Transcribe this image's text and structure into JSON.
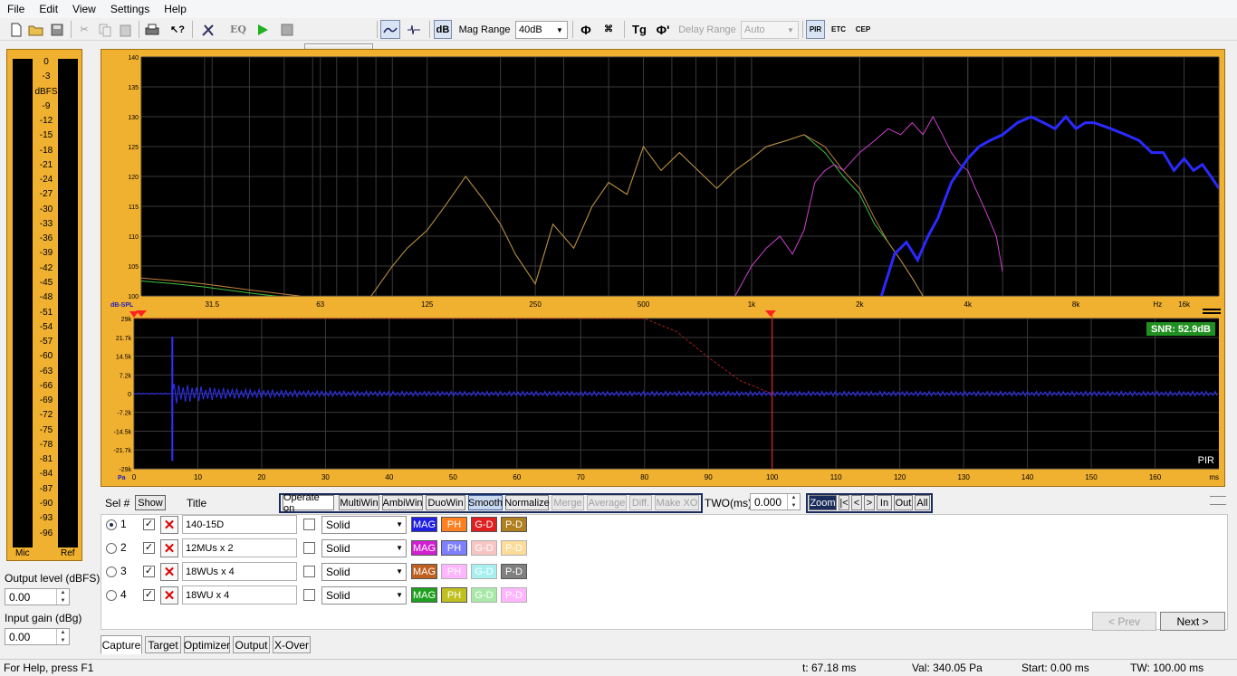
{
  "menu": [
    "File",
    "Edit",
    "View",
    "Settings",
    "Help"
  ],
  "toolbar": {
    "eq_label": "EQ",
    "db_label": "dB",
    "mag_range_label": "Mag Range",
    "mag_range_value": "40dB",
    "tg_label": "Tg",
    "delay_range_label": "Delay Range",
    "delay_range_value": "Auto",
    "pir_label": "PIR",
    "etc_label": "ETC",
    "cep_label": "CEP"
  },
  "meters": {
    "unit": "dBFS",
    "scale": [
      "0",
      "-3",
      "-9",
      "-12",
      "-15",
      "-18",
      "-21",
      "-24",
      "-27",
      "-30",
      "-33",
      "-36",
      "-39",
      "-42",
      "-45",
      "-48",
      "-51",
      "-54",
      "-57",
      "-60",
      "-63",
      "-66",
      "-69",
      "-72",
      "-75",
      "-78",
      "-81",
      "-84",
      "-87",
      "-90",
      "-93",
      "-96"
    ],
    "mic_label": "Mic",
    "ref_label": "Ref"
  },
  "output_level": {
    "label": "Output level (dBFS)",
    "value": "0.00"
  },
  "input_gain": {
    "label": "Input gain (dBg)",
    "value": "0.00"
  },
  "colors": {
    "frame": "#f0b030",
    "plot_bg": "#000000",
    "grid": "#3a3a3a",
    "trace1": "#2a2aff",
    "trace2": "#d040d0",
    "trace3": "#c08040",
    "trace4": "#40c040",
    "pir": "#3030ff",
    "marker": "#ff2020"
  },
  "chart_data": [
    {
      "type": "line",
      "title": "",
      "xlabel": "Hz",
      "ylabel": "dB-SPL",
      "x_scale": "log",
      "xlim": [
        20,
        20000
      ],
      "ylim": [
        100,
        140
      ],
      "xticks": [
        {
          "v": 31.5,
          "label": "31.5"
        },
        {
          "v": 63,
          "label": "63"
        },
        {
          "v": 125,
          "label": "125"
        },
        {
          "v": 250,
          "label": "250"
        },
        {
          "v": 500,
          "label": "500"
        },
        {
          "v": 1000,
          "label": "1k"
        },
        {
          "v": 2000,
          "label": "2k"
        },
        {
          "v": 4000,
          "label": "4k"
        },
        {
          "v": 8000,
          "label": "8k"
        },
        {
          "v": 16000,
          "label": "16k"
        }
      ],
      "yticks": [
        100,
        105,
        110,
        115,
        120,
        125,
        130,
        135,
        140
      ],
      "series": [
        {
          "name": "140-15D",
          "color": "#2a2aff",
          "x": [
            2300,
            2500,
            2700,
            2900,
            3100,
            3300,
            3600,
            4000,
            4300,
            4600,
            5000,
            5500,
            6000,
            6500,
            7000,
            7500,
            8000,
            8500,
            9000,
            10000,
            11000,
            12000,
            13000,
            14000,
            15000,
            16000,
            17000,
            18000,
            19000,
            20000
          ],
          "y": [
            100,
            107,
            109,
            106,
            110,
            113,
            119,
            123,
            125,
            126,
            127,
            129,
            130,
            129,
            128,
            130,
            128,
            129,
            129,
            128,
            127,
            126,
            124,
            124,
            121,
            123,
            121,
            122,
            120,
            118
          ]
        },
        {
          "name": "12MUs x 2",
          "color": "#d040d0",
          "x": [
            900,
            1000,
            1100,
            1200,
            1300,
            1400,
            1500,
            1600,
            1700,
            1800,
            2000,
            2200,
            2400,
            2600,
            2800,
            3000,
            3200,
            3400,
            3600,
            3800,
            4000,
            4200,
            4500,
            4800,
            5000
          ],
          "y": [
            100,
            105,
            108,
            110,
            107,
            111,
            119,
            121,
            122,
            121,
            124,
            126,
            128,
            127,
            129,
            127,
            130,
            127,
            124,
            122,
            121,
            118,
            114,
            110,
            104
          ]
        },
        {
          "name": "18WUs x 4",
          "color": "#c08040",
          "x": [
            20,
            25,
            30,
            40,
            55,
            70,
            85,
            100,
            110,
            125,
            140,
            160,
            180,
            200,
            220,
            250,
            280,
            320,
            360,
            400,
            450,
            500,
            560,
            630,
            710,
            800,
            900,
            1000,
            1100,
            1250,
            1400,
            1600,
            1800,
            2000,
            2200,
            2400,
            2600,
            2800,
            3000
          ],
          "y": [
            103,
            102.5,
            102,
            101,
            100,
            98,
            99,
            105,
            108,
            111,
            115,
            120,
            116,
            112,
            107,
            102,
            112,
            108,
            115,
            119,
            117,
            125,
            121,
            124,
            121,
            118,
            121,
            123,
            125,
            126,
            127,
            125,
            121,
            118,
            113,
            109,
            106,
            103,
            100
          ]
        },
        {
          "name": "18WU x 4",
          "color": "#40c040",
          "x": [
            20,
            25,
            30,
            40,
            55,
            70,
            85,
            100,
            110,
            125,
            140,
            160,
            180,
            200,
            220,
            250,
            280,
            320,
            360,
            400,
            450,
            500,
            560,
            630,
            710,
            800,
            900,
            1000,
            1100,
            1250,
            1400,
            1600,
            1800,
            2000,
            2200,
            2400,
            2600,
            2800,
            3000
          ],
          "y": [
            102.5,
            102,
            101.5,
            100.5,
            99.5,
            98,
            99,
            105,
            108,
            111,
            115,
            120,
            116,
            112,
            107,
            102,
            112,
            108,
            115,
            119,
            117,
            125,
            121,
            124,
            121,
            118,
            121,
            123,
            125,
            126,
            127,
            124,
            120,
            117,
            112,
            109,
            106,
            103,
            100
          ]
        }
      ]
    },
    {
      "type": "line",
      "title": "PIR",
      "xlabel": "ms",
      "ylabel": "Pa",
      "xlim": [
        0,
        170
      ],
      "ylim": [
        -29000,
        29000
      ],
      "xticks": [
        0,
        10,
        20,
        30,
        40,
        50,
        60,
        70,
        80,
        90,
        100,
        110,
        120,
        130,
        140,
        150,
        160
      ],
      "ytick_labels": [
        {
          "v": 29000,
          "label": "29k"
        },
        {
          "v": 21700,
          "label": "21.7k"
        },
        {
          "v": 14500,
          "label": "14.5k"
        },
        {
          "v": 7200,
          "label": "7.2k"
        },
        {
          "v": 0,
          "label": "0"
        },
        {
          "v": -7200,
          "label": "-7.2k"
        },
        {
          "v": -14500,
          "label": "-14.5k"
        },
        {
          "v": -21700,
          "label": "-21.7k"
        },
        {
          "v": -29000,
          "label": "-29k"
        }
      ],
      "snr_label": "SNR: 52.9dB",
      "impulse_peak_ms": 6,
      "impulse_max": 22000,
      "impulse_min": -26000,
      "marker_ms": 100,
      "window": {
        "x": [
          0,
          80,
          85,
          90,
          95,
          100
        ],
        "y": [
          29000,
          29000,
          24000,
          14000,
          5000,
          0
        ]
      }
    }
  ],
  "panel": {
    "sel_label": "Sel #",
    "show_label": "Show",
    "title_label": "Title",
    "operate_buttons": [
      "Operate on",
      "MultiWin",
      "AmbiWin",
      "DuoWin",
      "Smooth",
      "Normalize",
      "Merge",
      "Average",
      "Diff.",
      "Make XO"
    ],
    "two_label": "TWO(ms)",
    "two_value": "0.000",
    "zoom_buttons": [
      "Zoom",
      "|<",
      "<",
      ">",
      "In",
      "Out",
      "All"
    ],
    "rows": [
      {
        "num": "1",
        "title": "140-15D",
        "style": "Solid",
        "mag": "MAG",
        "ph": "PH",
        "gd": "G-D",
        "pd": "P-D"
      },
      {
        "num": "2",
        "title": "12MUs x 2",
        "style": "Solid",
        "mag": "MAG",
        "ph": "PH",
        "gd": "G-D",
        "pd": "P-D"
      },
      {
        "num": "3",
        "title": "18WUs x 4",
        "style": "Solid",
        "mag": "MAG",
        "ph": "PH",
        "gd": "G-D",
        "pd": "P-D"
      },
      {
        "num": "4",
        "title": "18WU x 4",
        "style": "Solid",
        "mag": "MAG",
        "ph": "PH",
        "gd": "G-D",
        "pd": "P-D"
      }
    ],
    "prev_label": "< Prev",
    "next_label": "Next >"
  },
  "tabs": [
    "Capture",
    "Target",
    "Optimizer",
    "Output",
    "X-Over"
  ],
  "status": {
    "help": "For Help, press F1",
    "t": "t: 67.18 ms",
    "val": "Val: 340.05 Pa",
    "start": "Start: 0.00 ms",
    "tw": "TW: 100.00 ms"
  }
}
